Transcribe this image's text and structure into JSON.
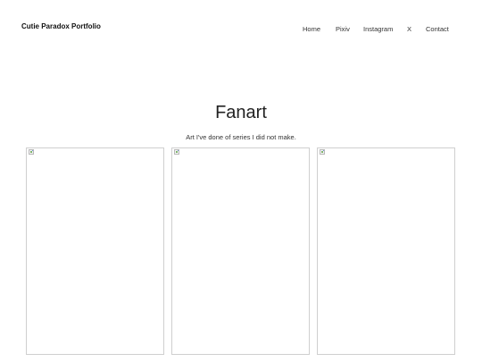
{
  "site": {
    "title": "Cutie Paradox Portfolio"
  },
  "nav": {
    "items": [
      {
        "label": "Home"
      },
      {
        "label": "Pixiv"
      },
      {
        "label": "Instagram"
      },
      {
        "label": "X"
      },
      {
        "label": "Contact"
      }
    ]
  },
  "main": {
    "title": "Fanart",
    "subtitle": "Art I've done of series I did not make."
  },
  "gallery": {
    "items": [
      {
        "icon": "broken-image-icon"
      },
      {
        "icon": "broken-image-icon"
      },
      {
        "icon": "broken-image-icon"
      }
    ]
  }
}
